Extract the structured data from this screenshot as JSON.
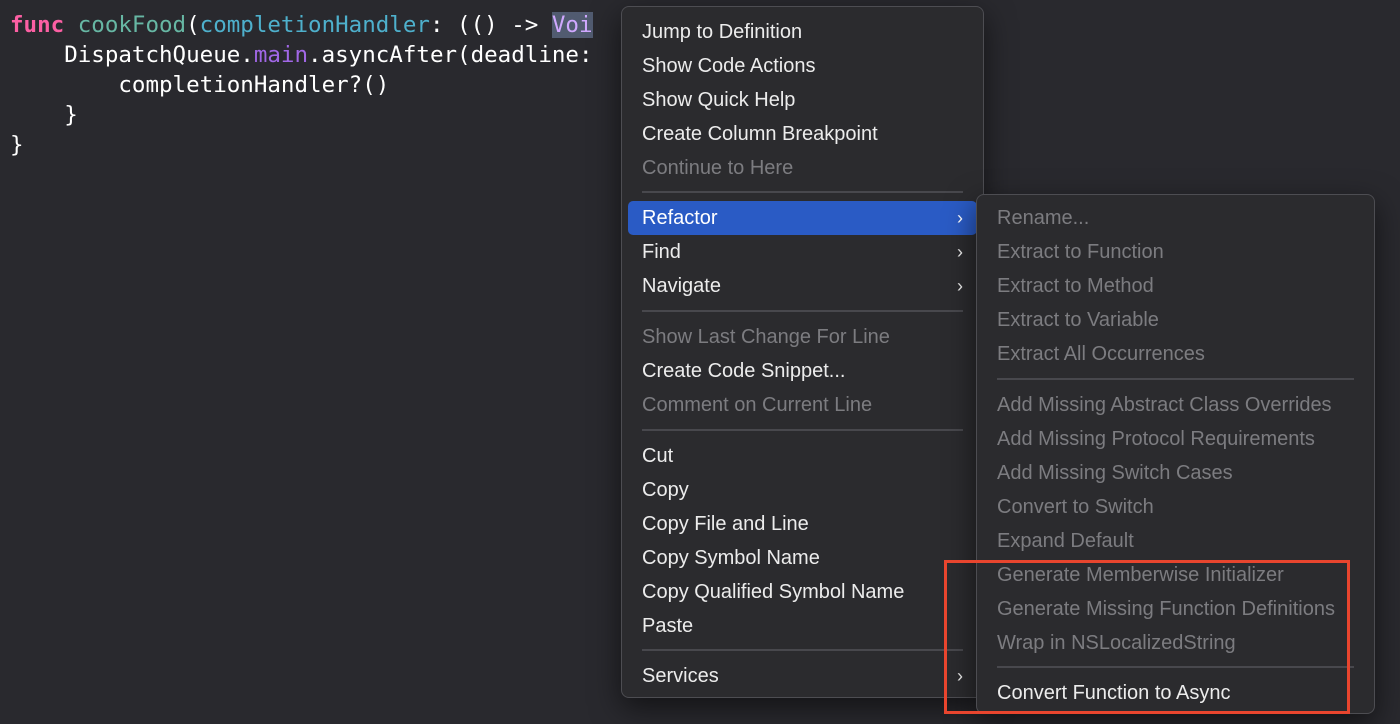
{
  "code": {
    "line1": {
      "keyword": "func",
      "name": "cookFood",
      "open": "(",
      "param": "completionHandler",
      "sig": ": (() -> ",
      "selected": "Voi"
    },
    "line2": {
      "obj": "DispatchQueue",
      "dot": ".",
      "prop": "main",
      "rest": ".asyncAfter(deadline:"
    },
    "line3": "completionHandler?()",
    "line4": "}",
    "line5": "}"
  },
  "context_menu": {
    "jump_to_definition": "Jump to Definition",
    "show_code_actions": "Show Code Actions",
    "show_quick_help": "Show Quick Help",
    "create_column_breakpoint": "Create Column Breakpoint",
    "continue_to_here": "Continue to Here",
    "refactor": "Refactor",
    "find": "Find",
    "navigate": "Navigate",
    "show_last_change": "Show Last Change For Line",
    "create_code_snippet": "Create Code Snippet...",
    "comment_on_line": "Comment on Current Line",
    "cut": "Cut",
    "copy": "Copy",
    "copy_file_and_line": "Copy File and Line",
    "copy_symbol_name": "Copy Symbol Name",
    "copy_qualified_symbol_name": "Copy Qualified Symbol Name",
    "paste": "Paste",
    "services": "Services",
    "chevron": "›"
  },
  "refactor_menu": {
    "rename": "Rename...",
    "extract_function": "Extract to Function",
    "extract_method": "Extract to Method",
    "extract_variable": "Extract to Variable",
    "extract_all": "Extract All Occurrences",
    "add_abstract_overrides": "Add Missing Abstract Class Overrides",
    "add_protocol_requirements": "Add Missing Protocol Requirements",
    "add_switch_cases": "Add Missing Switch Cases",
    "convert_to_switch": "Convert to Switch",
    "expand_default": "Expand Default",
    "memberwise_initializer": "Generate Memberwise Initializer",
    "missing_function_defs": "Generate Missing Function Definitions",
    "wrap_nslocalized": "Wrap in NSLocalizedString",
    "convert_to_async": "Convert Function to Async"
  },
  "colors": {
    "highlight_box": "#e8452e",
    "selection": "#2a5bc5"
  },
  "icons": {
    "submenu": "chevron-right-icon"
  }
}
